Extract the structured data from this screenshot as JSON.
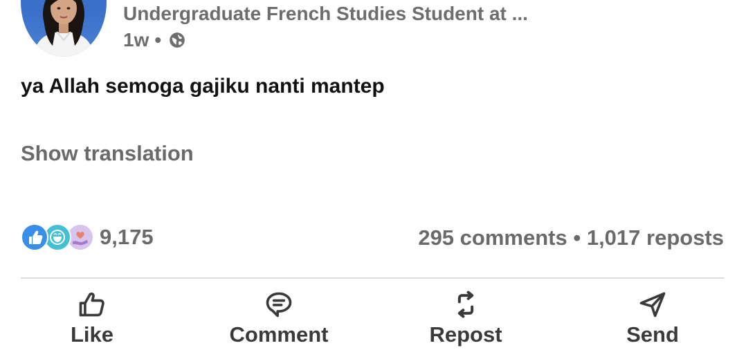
{
  "post": {
    "author_subtitle": "Undergraduate French Studies Student at ...",
    "timestamp": "1w",
    "separator": "•",
    "visibility_icon": "globe-icon",
    "text": "ya Allah semoga gajiku nanti mantep",
    "translation_link": "Show translation"
  },
  "social": {
    "reaction_icons": [
      "like-reaction-icon",
      "funny-reaction-icon",
      "support-reaction-icon"
    ],
    "reaction_count": "9,175",
    "comments": "295 comments",
    "separator": "•",
    "reposts": "1,017 reposts"
  },
  "actions": {
    "like_label": "Like",
    "comment_label": "Comment",
    "repost_label": "Repost",
    "send_label": "Send"
  },
  "colors": {
    "avatar_bg": "#3f79d3",
    "muted_text": "#6a6a6a",
    "like_blue": "#378fe9",
    "funny_teal": "#44bfd3",
    "support_purple": "#c5a6e0"
  }
}
